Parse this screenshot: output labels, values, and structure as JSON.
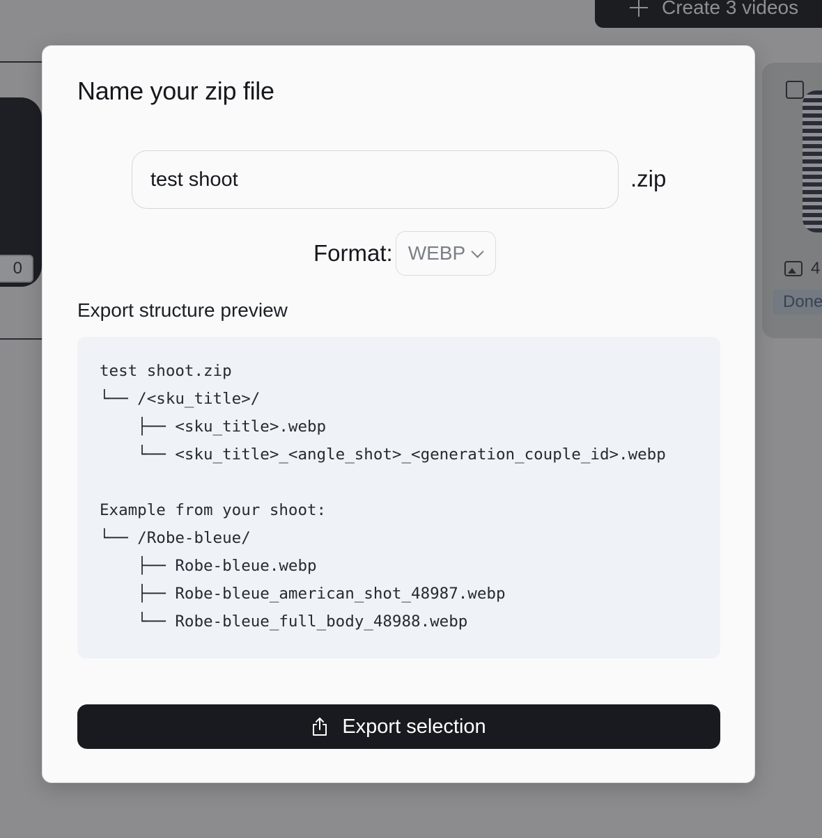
{
  "background": {
    "create_button_label": "Create 3 videos",
    "left_card_count": "0",
    "right_card_image_count": "4",
    "right_card_status": "Done"
  },
  "modal": {
    "title": "Name your zip file",
    "filename_value": "test shoot",
    "extension": ".zip",
    "format_label": "Format:",
    "format_value": "WEBP",
    "preview_heading": "Export structure preview",
    "preview_lines": [
      "test shoot.zip",
      "└── /<sku_title>/",
      "    ├── <sku_title>.webp",
      "    └── <sku_title>_<angle_shot>_<generation_couple_id>.webp",
      "",
      "Example from your shoot:",
      "└── /Robe-bleue/",
      "    ├── Robe-bleue.webp",
      "    ├── Robe-bleue_american_shot_48987.webp",
      "    └── Robe-bleue_full_body_48988.webp"
    ],
    "export_button_label": "Export selection"
  },
  "colors": {
    "overlay": "#8c8c8e",
    "modal_bg": "#fafafb",
    "preview_bg": "#eff2f7",
    "primary_button": "#181a1f"
  },
  "icons": {
    "create": "plus-icon",
    "format_dropdown": "chevron-down-icon",
    "export": "share-upload-icon",
    "image_count": "image-icon"
  }
}
